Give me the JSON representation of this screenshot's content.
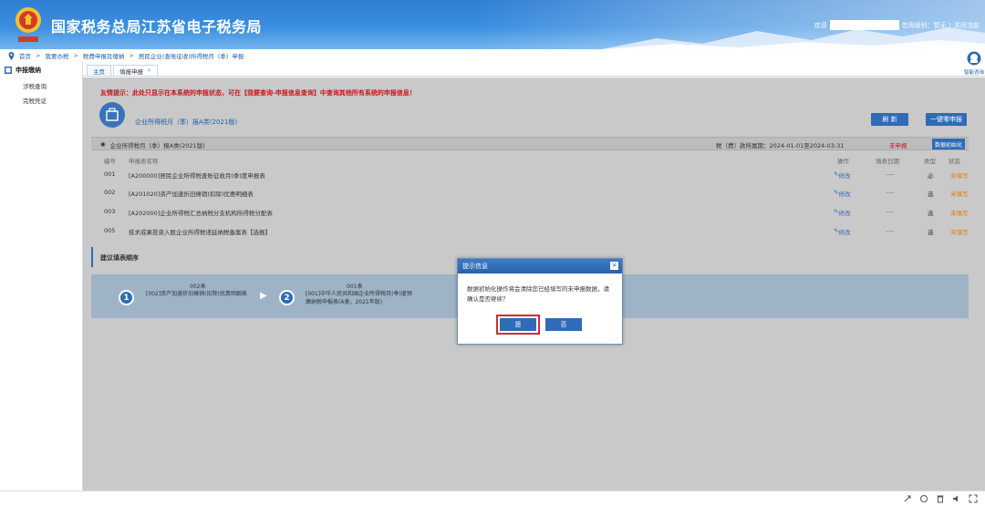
{
  "header": {
    "title": "国家税务总局江苏省电子税务局",
    "welcome": "欢迎",
    "credit_label": "信用级别：暂无",
    "close_link": "关闭当前"
  },
  "breadcrumb": [
    "首页",
    "我要办税",
    "税费申报及缴纳",
    "居民企业(查账征收)所得税月（季）申报"
  ],
  "sidebar": {
    "title": "申报缴纳",
    "items": [
      "涉税查询",
      "完税凭证"
    ]
  },
  "tabs": [
    {
      "label": "主页",
      "active": false
    },
    {
      "label": "填报申报",
      "active": true
    }
  ],
  "help_label": "智能咨询",
  "main": {
    "tip": "友情提示：此处只显示在本系统的申报状态，可在【我要查询-申报信息查询】中查询其他所有系统的申报信息！",
    "form_title": "企业所得税月（季）报A类(2021版)",
    "refresh_btn": "刷 新",
    "onekey_btn": "一键零申报",
    "section_title": "企业所得税月（季）报A类(2021版)",
    "period": "税（费）款所属期：2024-01-01至2024-03-31",
    "status": "未申报",
    "init_btn": "数据初始化",
    "columns": [
      "编号",
      "申报表名称",
      "操作",
      "填表日期",
      "类型",
      "状态"
    ],
    "rows": [
      {
        "code": "001",
        "name": "[A200000]居民企业所得税查账征收月(季)度申报表",
        "op": "修改",
        "date": "----",
        "type": "必",
        "state": "未填写"
      },
      {
        "code": "002",
        "name": "[A201020]资产加速折旧摊销(扣除)优惠明细表",
        "op": "修改",
        "date": "----",
        "type": "选",
        "state": "未填写"
      },
      {
        "code": "003",
        "name": "[A202000]企业所得税汇总纳税分支机构所得税分配表",
        "op": "修改",
        "date": "----",
        "type": "选",
        "state": "未填写"
      },
      {
        "code": "005",
        "name": "技术成果投资入股企业所得税递延纳税备案表【选报】",
        "op": "修改",
        "date": "----",
        "type": "选",
        "state": "未填写"
      }
    ],
    "suggest_title": "建议填表顺序",
    "steps": [
      {
        "num": "1",
        "sub": "002表",
        "text": "[002]资产加速折旧摊销(扣除)优惠明细表"
      },
      {
        "num": "2",
        "sub": "001表",
        "text": "[001]中华人民共和国企业所得税月(季)度预缴纳税申报表(A类，2021年版)"
      }
    ]
  },
  "modal": {
    "title": "提示信息",
    "message": "数据初始化操作将会清除您已经填写的未申报数据，请确认是否继续？",
    "yes": "是",
    "no": "否"
  }
}
